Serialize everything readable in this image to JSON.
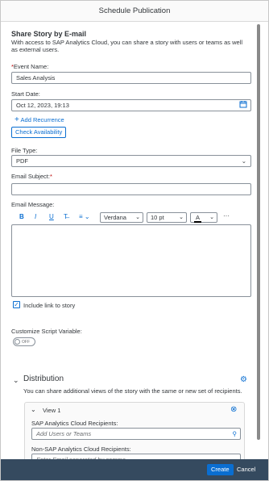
{
  "window": {
    "title": "Schedule Publication"
  },
  "intro": {
    "heading": "Share Story by E-mail",
    "description": "With access to SAP Analytics Cloud, you can share a story with users or teams as well as external users."
  },
  "event": {
    "label": "Event Name:",
    "value": "Sales Analysis"
  },
  "start": {
    "label": "Start Date:",
    "value": "Oct 12, 2023, 19:13",
    "add_recurrence": "Add Recurrence",
    "check_availability": "Check Availability"
  },
  "filetype": {
    "label": "File Type:",
    "value": "PDF"
  },
  "subject": {
    "label": "Email Subject:",
    "value": ""
  },
  "message": {
    "label": "Email Message:",
    "font": "Verdana",
    "size": "10 pt"
  },
  "include_link": {
    "label": "Include link to story",
    "checked": true
  },
  "script_var": {
    "label": "Customize Script Variable:",
    "toggle": "OFF"
  },
  "distribution": {
    "title": "Distribution",
    "description": "You can share additional views of the story with the same or new set of recipients.",
    "view_name": "View 1",
    "sac_label": "SAP Analytics Cloud Recipients:",
    "sac_placeholder": "Add Users or Teams",
    "nonsac_label": "Non-SAP Analytics Cloud Recipients:",
    "nonsac_placeholder": "Enter Email separated by comma"
  },
  "footer": {
    "create": "Create",
    "cancel": "Cancel"
  }
}
